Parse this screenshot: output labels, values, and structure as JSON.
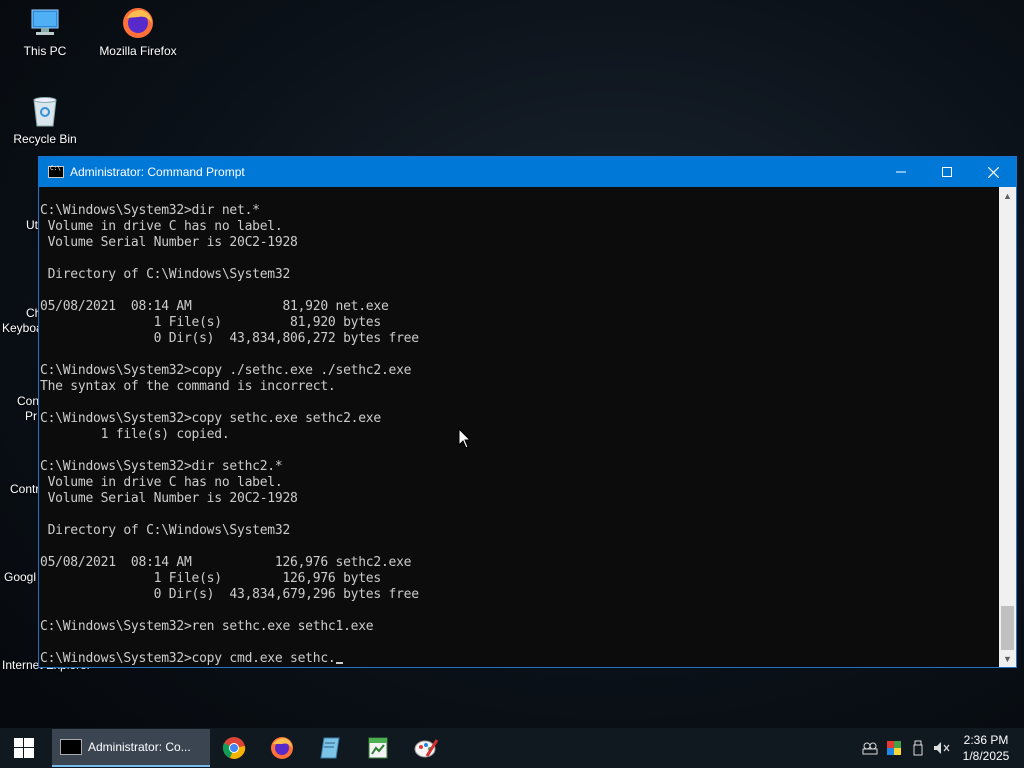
{
  "desktop": {
    "icons": [
      {
        "label": "This PC"
      },
      {
        "label": "Mozilla Firefox"
      },
      {
        "label": "Recycle Bin"
      }
    ],
    "partial_labels": [
      "Ut",
      "Ch",
      "Keyboa",
      "Con",
      "Pr",
      "Contr",
      "Googl",
      "Internet Explorer"
    ]
  },
  "window": {
    "title": "Administrator: Command Prompt",
    "lines": [
      "C:\\Windows\\System32>dir net.*",
      " Volume in drive C has no label.",
      " Volume Serial Number is 20C2-1928",
      "",
      " Directory of C:\\Windows\\System32",
      "",
      "05/08/2021  08:14 AM            81,920 net.exe",
      "               1 File(s)         81,920 bytes",
      "               0 Dir(s)  43,834,806,272 bytes free",
      "",
      "C:\\Windows\\System32>copy ./sethc.exe ./sethc2.exe",
      "The syntax of the command is incorrect.",
      "",
      "C:\\Windows\\System32>copy sethc.exe sethc2.exe",
      "        1 file(s) copied.",
      "",
      "C:\\Windows\\System32>dir sethc2.*",
      " Volume in drive C has no label.",
      " Volume Serial Number is 20C2-1928",
      "",
      " Directory of C:\\Windows\\System32",
      "",
      "05/08/2021  08:14 AM           126,976 sethc2.exe",
      "               1 File(s)        126,976 bytes",
      "               0 Dir(s)  43,834,679,296 bytes free",
      "",
      "C:\\Windows\\System32>ren sethc.exe sethc1.exe",
      ""
    ],
    "prompt_line": "C:\\Windows\\System32>copy cmd.exe sethc."
  },
  "taskbar": {
    "active_task": "Administrator: Co...",
    "pinned": [
      "chrome-icon",
      "firefox-icon",
      "notepad-icon",
      "spreadsheet-icon",
      "paint-icon"
    ],
    "clock_time": "2:36 PM",
    "clock_date": "1/8/2025"
  }
}
